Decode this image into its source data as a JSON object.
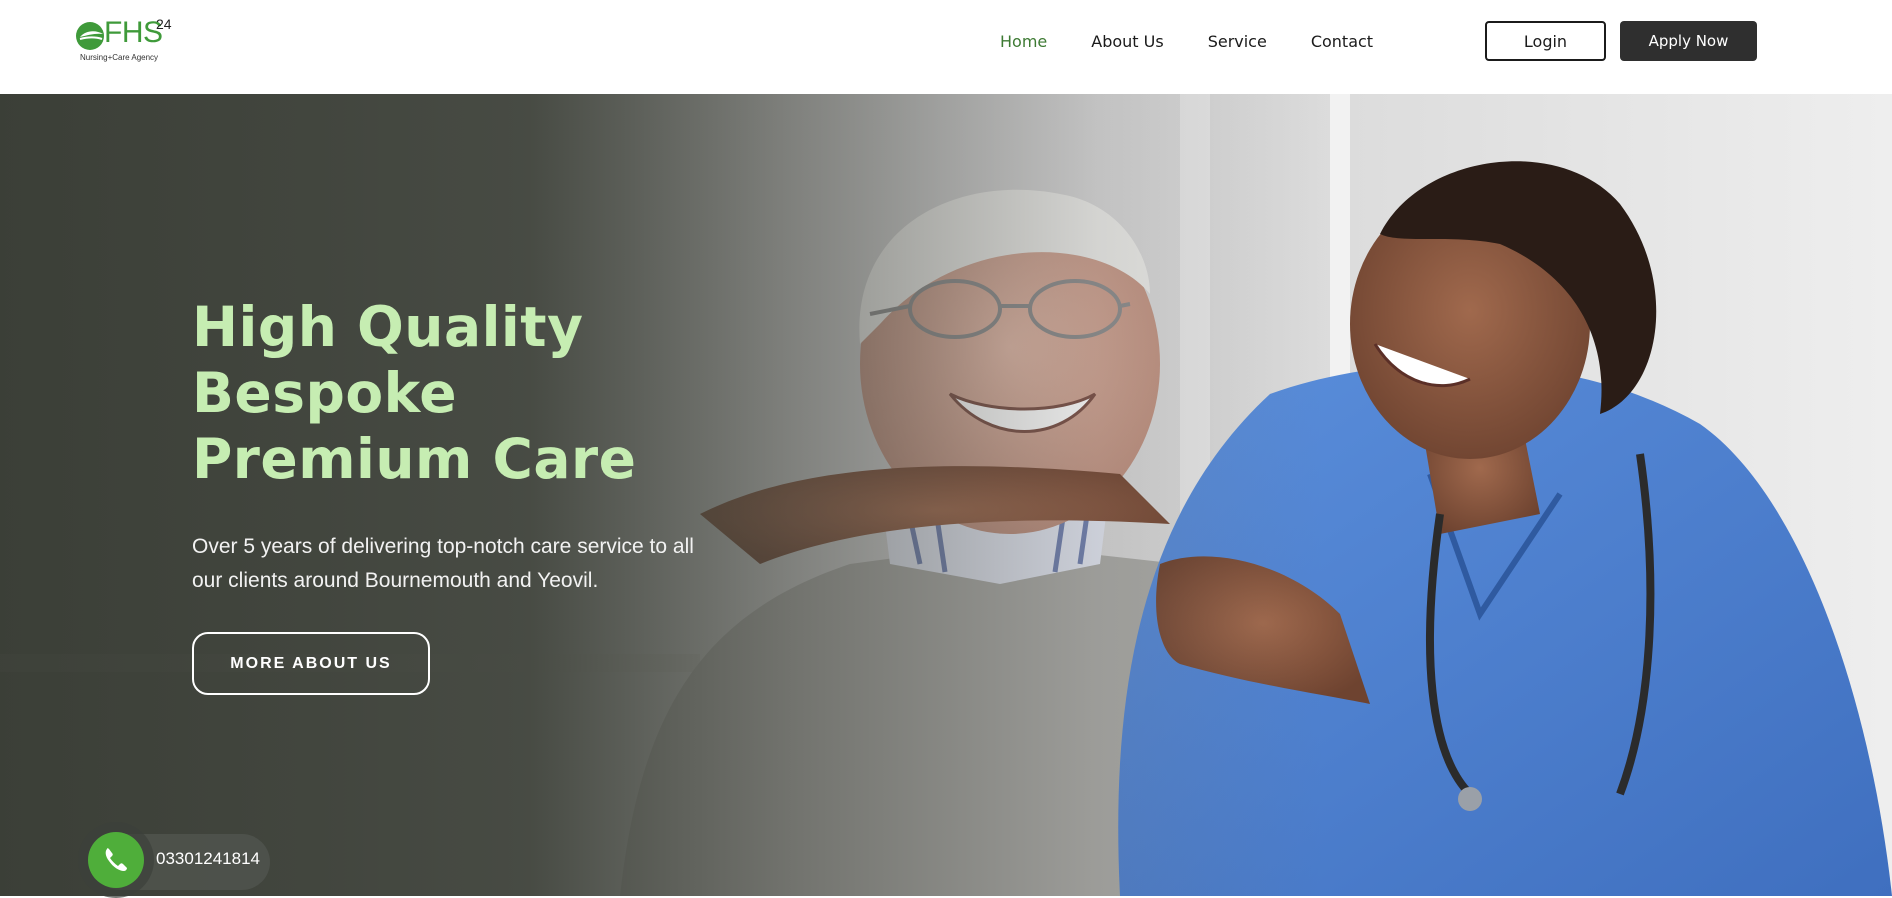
{
  "brand": {
    "logo_text": "FHS",
    "logo_superscript": "24",
    "logo_tagline": "Nursing+Care Agency",
    "accent_color": "#3f9a3a"
  },
  "nav": {
    "items": [
      {
        "label": "Home",
        "active": true
      },
      {
        "label": "About Us",
        "active": false
      },
      {
        "label": "Service",
        "active": false
      },
      {
        "label": "Contact",
        "active": false
      }
    ],
    "login_label": "Login",
    "apply_label": "Apply Now"
  },
  "hero": {
    "title_lines": [
      "High Quality",
      "Bespoke",
      "Premium Care"
    ],
    "subtitle": "Over 5 years of delivering top-notch care service to all our clients around Bournemouth and Yeovil.",
    "cta_label": "MORE ABOUT US",
    "title_color": "#c6edb2"
  },
  "phone": {
    "number": "03301241814",
    "icon": "phone-icon",
    "color": "#4fae3a"
  }
}
